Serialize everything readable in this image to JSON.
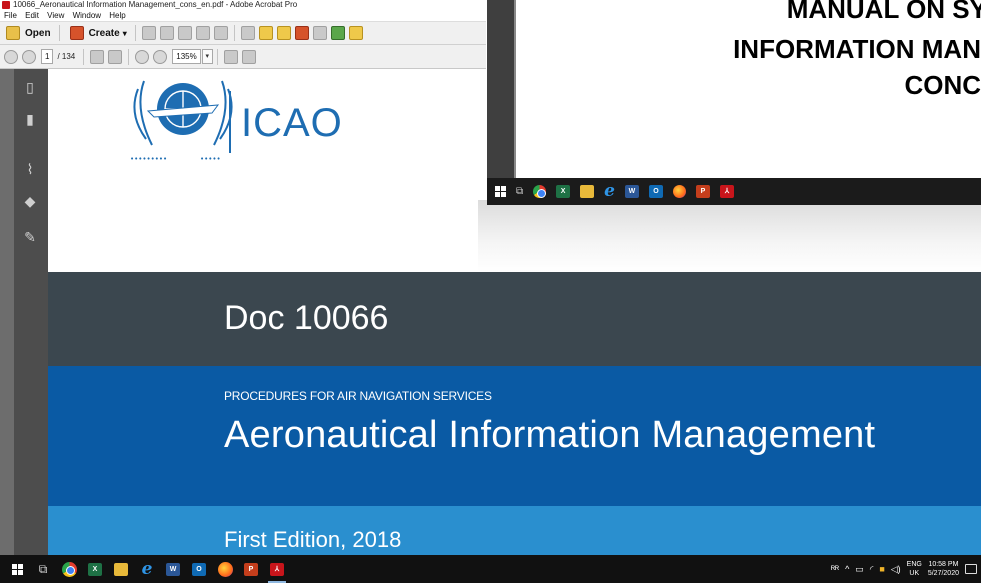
{
  "window": {
    "title": "10066_Aeronautical Information Management_cons_en.pdf - Adobe Acrobat Pro"
  },
  "menu": {
    "items": [
      "File",
      "Edit",
      "View",
      "Window",
      "Help"
    ]
  },
  "toolbar": {
    "open_label": "Open",
    "create_label": "Create",
    "create_caret": "▾",
    "page_current": "1",
    "page_total": "/ 134",
    "zoom_value": "135%",
    "zoom_caret": "▾"
  },
  "document": {
    "org_name": "ICAO",
    "doc_number": "Doc 10066",
    "series": "PROCEDURES FOR AIR NAVIGATION SERVICES",
    "title": "Aeronautical Information Management",
    "edition": "First Edition, 2018"
  },
  "overlay_window": {
    "lines": [
      "MANUAL ON SY",
      "INFORMATION MAN",
      "CONC"
    ]
  },
  "taskbar": {
    "apps": [
      "start",
      "task-view",
      "chrome",
      "excel",
      "file-explorer",
      "internet-explorer",
      "word",
      "outlook",
      "firefox",
      "powerpoint",
      "acrobat"
    ],
    "tray": {
      "people": "ᴿᴿ",
      "chevron": "^",
      "lang_top": "ENG",
      "lang_bottom": "UK",
      "time": "10:58 PM",
      "date": "5/27/2020"
    }
  },
  "colors": {
    "dark_band": "#3b474f",
    "blue_band": "#0a5aa4",
    "light_band": "#2a8fcf",
    "icao_blue": "#1e6db2"
  }
}
